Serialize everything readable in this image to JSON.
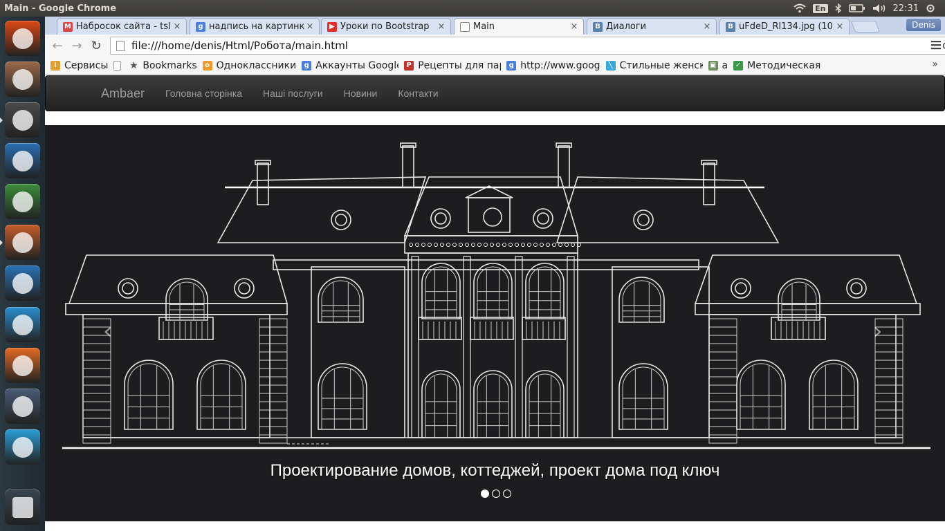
{
  "window": {
    "title": "Main - Google Chrome"
  },
  "panel": {
    "lang": "En",
    "time": "22:31",
    "user": "Denis"
  },
  "launcher": [
    {
      "name": "ubuntu-dash-icon",
      "color": "#dd4814"
    },
    {
      "name": "file-manager-icon",
      "color": "#9a6a4a"
    },
    {
      "name": "sublime-text-icon",
      "color": "#4b4b4b"
    },
    {
      "name": "jetbrains-icon",
      "color": "#2a6fb5"
    },
    {
      "name": "android-studio-icon",
      "color": "#3c8c3c"
    },
    {
      "name": "chrome-icon",
      "color": "#c65c2a"
    },
    {
      "name": "libreoffice-writer-icon",
      "color": "#2a73b8"
    },
    {
      "name": "skype-icon",
      "color": "#2a8fd0"
    },
    {
      "name": "software-center-icon",
      "color": "#e36b24"
    },
    {
      "name": "system-settings-icon",
      "color": "#4a5b75"
    },
    {
      "name": "telegram-icon",
      "color": "#2c9fd8"
    },
    {
      "name": "trash-icon",
      "color": "#3a4550"
    }
  ],
  "tabs": [
    {
      "label": "Набросок сайта - tsl",
      "favicon": "M",
      "favcolor": "#d44",
      "active": false
    },
    {
      "label": "надпись на картинк",
      "favicon": "g",
      "favcolor": "#4a7fe0",
      "active": false
    },
    {
      "label": "Уроки по Bootstrap",
      "favicon": "▶",
      "favcolor": "#e52d27",
      "active": false
    },
    {
      "label": "Main",
      "favicon": "",
      "favcolor": "#ffffff",
      "active": true
    },
    {
      "label": "Диалоги",
      "favicon": "В",
      "favcolor": "#5b7fa6",
      "active": false
    },
    {
      "label": "uFdeD_Rl134.jpg (10",
      "favicon": "В",
      "favcolor": "#5b7fa6",
      "active": false
    }
  ],
  "address": {
    "url": "file:///home/denis/Html/Робота/main.html"
  },
  "bookmarks": [
    {
      "label": "Сервисы",
      "icon": "apps-icon",
      "favicon": "⁞",
      "favcolor": "#e0a030"
    },
    {
      "label": "",
      "icon": "page-icon",
      "favicon": "",
      "favcolor": "#ffffff"
    },
    {
      "label": "Bookmarks",
      "icon": "star-icon",
      "favicon": "★",
      "favcolor": "#555555"
    },
    {
      "label": "Одноклассники",
      "icon": "ok-icon",
      "favicon": "о",
      "favcolor": "#f29a2b"
    },
    {
      "label": "Аккаунты Google",
      "icon": "google-icon",
      "favicon": "g",
      "favcolor": "#4a7fe0"
    },
    {
      "label": "Рецепты для пар",
      "icon": "recipes-icon",
      "favicon": "Р",
      "favcolor": "#c0322b"
    },
    {
      "label": "http://www.goog",
      "icon": "google-icon",
      "favicon": "g",
      "favcolor": "#4a7fe0"
    },
    {
      "label": "Стильные женск",
      "icon": "hanger-icon",
      "favicon": "╲",
      "favcolor": "#3aa8d8"
    },
    {
      "label": "а",
      "icon": "image-icon",
      "favicon": "▣",
      "favcolor": "#6b8f5a"
    },
    {
      "label": "Методическая р",
      "icon": "check-icon",
      "favicon": "✓",
      "favcolor": "#3a9a4a"
    }
  ],
  "site": {
    "brand": "Ambaer",
    "nav": [
      "Головна сторінка",
      "Наші послуги",
      "Новини",
      "Контакти"
    ],
    "carousel": {
      "caption": "Проектирование домов, коттеджей, проект дома под ключ",
      "slides": 3,
      "active_slide": 1,
      "prev": "‹",
      "next": "›"
    }
  }
}
